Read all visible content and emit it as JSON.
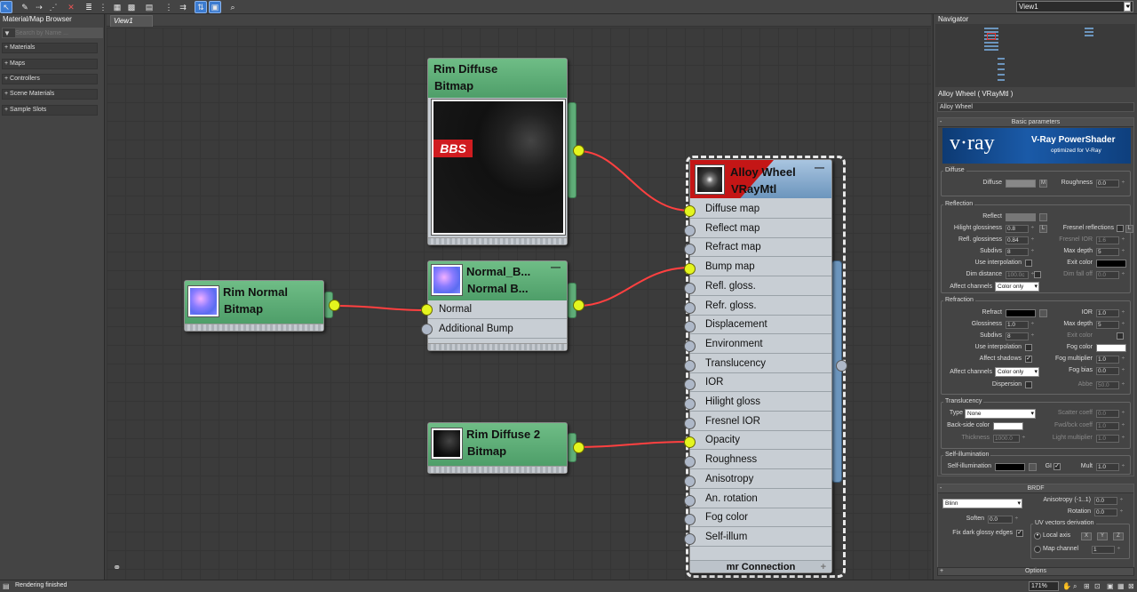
{
  "left_panel": {
    "title": "Material/Map Browser",
    "search_placeholder": "Search by Name ...",
    "categories": [
      "+ Materials",
      "+ Maps",
      "+ Controllers",
      "+ Scene Materials",
      "+ Sample Slots"
    ]
  },
  "view_tab": "View1",
  "view_select": "View1",
  "nodes": {
    "rim_diffuse": {
      "line1": "Rim Diffuse",
      "line2": "Bitmap",
      "thumb_text": "BBS"
    },
    "normal_bump": {
      "line1": "Normal_B...",
      "line2": "Normal B...",
      "slots": [
        "Normal",
        "Additional Bump"
      ],
      "min": "—"
    },
    "rim_normal": {
      "line1": "Rim Normal",
      "line2": "Bitmap"
    },
    "rim_diffuse2": {
      "line1": "Rim Diffuse 2",
      "line2": "Bitmap"
    },
    "alloy": {
      "line1": "Alloy Wheel",
      "line2": "VRayMtl",
      "min": "—",
      "slots": [
        "Diffuse map",
        "Reflect map",
        "Refract map",
        "Bump map",
        "Refl. gloss.",
        "Refr. gloss.",
        "Displacement",
        "Environment",
        "Translucency",
        "IOR",
        "Hilight gloss",
        "Fresnel IOR",
        "Opacity",
        "Roughness",
        "Anisotropy",
        "An. rotation",
        "Fog color",
        "Self-illum"
      ],
      "footer": "mr Connection",
      "plus": "+"
    }
  },
  "navigator": {
    "title": "Navigator"
  },
  "props": {
    "title": "Alloy Wheel  ( VRayMtl )",
    "name": "Alloy Wheel",
    "basic_header": "Basic parameters",
    "vray": {
      "logo": "v·ray",
      "t1": "V-Ray PowerShader",
      "t2": "optimized for V-Ray"
    },
    "diffuse": {
      "group": "Diffuse",
      "diffuse": "Diffuse",
      "m": "M",
      "roughness": "Roughness",
      "roughness_val": "0.0"
    },
    "reflection": {
      "group": "Reflection",
      "reflect": "Reflect",
      "hilight": "Hilight glossiness",
      "hilight_val": "0.8",
      "l": "L",
      "fresnel": "Fresnel reflections",
      "fresnel_l": "L",
      "refl_gloss": "Refl. glossiness",
      "refl_gloss_val": "0.84",
      "fresnel_ior": "Fresnel IOR",
      "fresnel_ior_val": "1.6",
      "subdivs": "Subdivs",
      "subdivs_val": "8",
      "max_depth": "Max depth",
      "max_depth_val": "5",
      "use_interp": "Use interpolation",
      "exit_color": "Exit color",
      "dim_dist": "Dim distance",
      "dim_dist_val": "100.0c",
      "dim_falloff": "Dim fall off",
      "dim_falloff_val": "0.0",
      "affect_ch": "Affect channels",
      "affect_ch_val": "Color only"
    },
    "refraction": {
      "group": "Refraction",
      "refract": "Refract",
      "ior": "IOR",
      "ior_val": "1.0",
      "gloss": "Glossiness",
      "gloss_val": "1.0",
      "max_depth": "Max depth",
      "max_depth_val": "5",
      "subdivs": "Subdivs",
      "subdivs_val": "8",
      "exit_color": "Exit color",
      "use_interp": "Use interpolation",
      "fog_color": "Fog color",
      "affect_shadows": "Affect shadows",
      "fog_mult": "Fog multiplier",
      "fog_mult_val": "1.0",
      "affect_ch": "Affect channels",
      "affect_ch_val": "Color only",
      "fog_bias": "Fog bias",
      "fog_bias_val": "0.0",
      "dispersion": "Dispersion",
      "abbe": "Abbe",
      "abbe_val": "50.0"
    },
    "translucency": {
      "group": "Translucency",
      "type": "Type",
      "type_val": "None",
      "scatter": "Scatter coeff",
      "scatter_val": "0.0",
      "backside": "Back-side color",
      "fwd": "Fwd/bck coeff",
      "fwd_val": "1.0",
      "thickness": "Thickness",
      "thickness_val": "1000.0",
      "light_mult": "Light multiplier",
      "light_mult_val": "1.0"
    },
    "selfillum": {
      "group": "Self-illumination",
      "label": "Self-illumination",
      "gi": "GI",
      "mult": "Mult",
      "mult_val": "1.0"
    },
    "brdf": {
      "header": "BRDF",
      "type": "Blinn",
      "aniso": "Anisotropy (-1..1)",
      "aniso_val": "0.0",
      "rotation": "Rotation",
      "rotation_val": "0.0",
      "soften": "Soften",
      "soften_val": "0.0",
      "uv": "UV vectors derivation",
      "local": "Local axis",
      "x": "X",
      "y": "Y",
      "z": "Z",
      "fix": "Fix dark glossy edges",
      "mapch": "Map channel",
      "mapch_val": "1"
    },
    "options": "Options"
  },
  "status": {
    "text": "Rendering finished",
    "zoom": "171%"
  },
  "colors": {
    "node_green": "#5aaa74",
    "node_blue": "#6c95bd",
    "wire": "#ff4040",
    "socket_yellow": "#e4f51e",
    "accent": "#3b7bd0"
  }
}
